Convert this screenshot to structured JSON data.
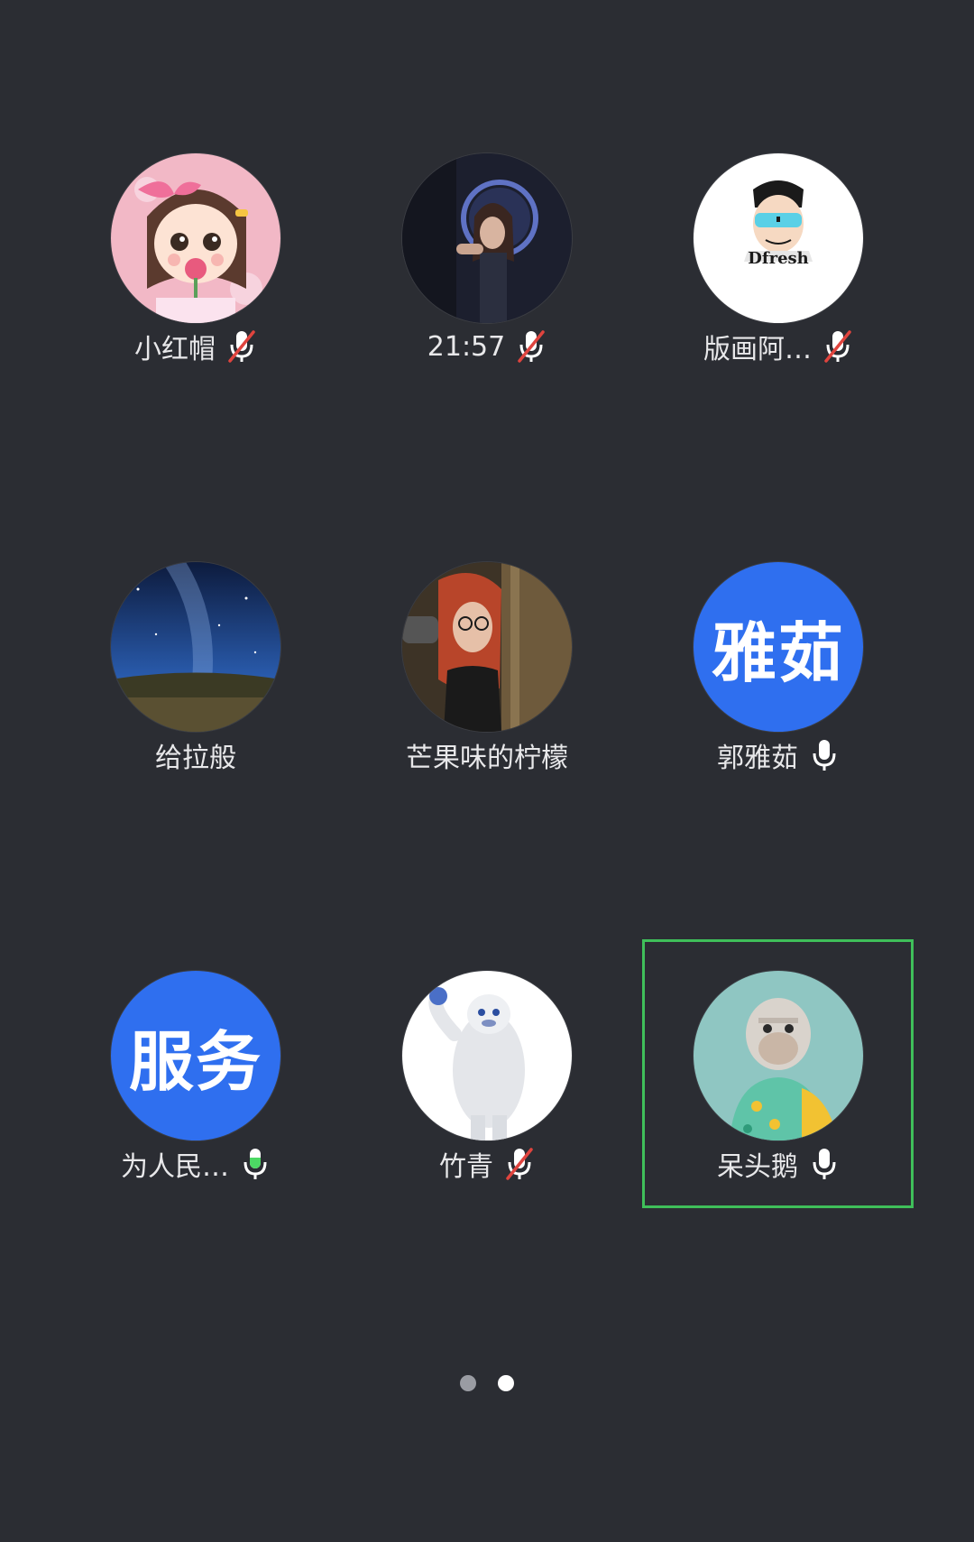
{
  "colors": {
    "background": "#2b2d33",
    "text_avatar_bg": "#2f6fef",
    "selected_border": "#3fbf5a",
    "mic_active_green": "#4cd964",
    "mic_muted_red": "#e0443e"
  },
  "participants": [
    {
      "name": "小红帽",
      "mic": "muted",
      "avatar_text": ""
    },
    {
      "name": "21:57",
      "mic": "muted",
      "avatar_text": ""
    },
    {
      "name": "版画阿…",
      "mic": "muted",
      "avatar_text": ""
    },
    {
      "name": "给拉般",
      "mic": "none",
      "avatar_text": ""
    },
    {
      "name": "芒果味的柠檬",
      "mic": "none",
      "avatar_text": ""
    },
    {
      "name": "郭雅茹",
      "mic": "on",
      "avatar_text": "雅茹"
    },
    {
      "name": "为人民…",
      "mic": "speaking",
      "avatar_text": "服务"
    },
    {
      "name": "竹青",
      "mic": "muted",
      "avatar_text": ""
    },
    {
      "name": "呆头鹅",
      "mic": "on",
      "avatar_text": ""
    }
  ],
  "avatar_images": {
    "p0": "cartoon-girl-with-flower",
    "p1": "woman-with-ring-light",
    "p2": "cartoon-man-sunglasses",
    "p2_logo_text": "Dfresh",
    "p3": "starry-night-sky",
    "p4": "red-haired-woman",
    "p7": "white-yeti-cartoon",
    "p8": "cartoon-ape-hawaiian-shirt"
  },
  "pager": {
    "pages": 2,
    "current": 2
  }
}
